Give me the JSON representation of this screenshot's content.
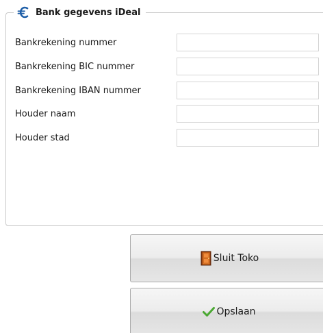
{
  "section": {
    "title": "Bank gegevens iDeal",
    "icon": "euro-icon",
    "accent_color": "#1f5fa8"
  },
  "fields": [
    {
      "label": "Bankrekening nummer",
      "value": ""
    },
    {
      "label": "Bankrekening BIC nummer",
      "value": ""
    },
    {
      "label": "Bankrekening IBAN nummer",
      "value": ""
    },
    {
      "label": "Houder naam",
      "value": ""
    },
    {
      "label": "Houder stad",
      "value": ""
    }
  ],
  "buttons": {
    "close": {
      "label": "Sluit Toko",
      "icon": "door-icon"
    },
    "save": {
      "label": "Opslaan",
      "icon": "checkmark-icon"
    }
  }
}
